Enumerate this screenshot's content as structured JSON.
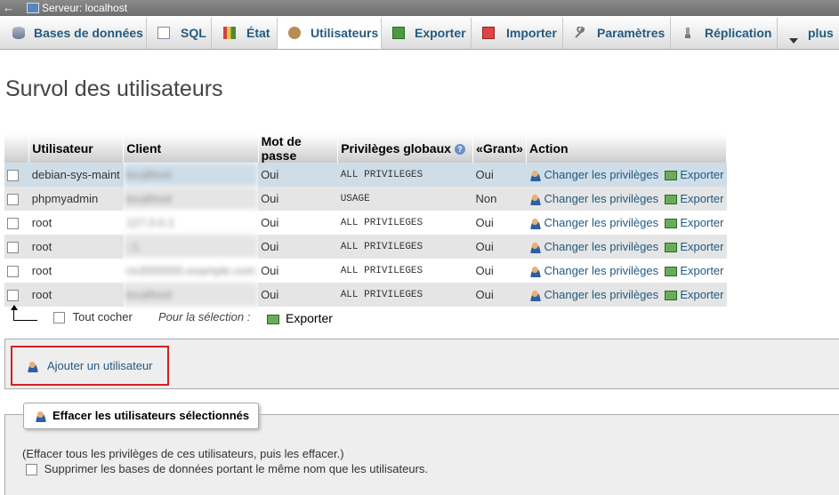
{
  "server_bar": {
    "back": "←",
    "title": "Serveur: localhost"
  },
  "tabs": [
    {
      "label": "Bases de données",
      "icon": "database-icon"
    },
    {
      "label": "SQL",
      "icon": "sql-icon"
    },
    {
      "label": "État",
      "icon": "status-icon"
    },
    {
      "label": "Utilisateurs",
      "icon": "users-icon",
      "active": true
    },
    {
      "label": "Exporter",
      "icon": "export-icon"
    },
    {
      "label": "Importer",
      "icon": "import-icon"
    },
    {
      "label": "Paramètres",
      "icon": "wrench-icon"
    },
    {
      "label": "Réplication",
      "icon": "replication-icon"
    },
    {
      "label": "plus",
      "icon": "chevron-down-icon"
    }
  ],
  "page_title": "Survol des utilisateurs",
  "table": {
    "headers": [
      "Utilisateur",
      "Client",
      "Mot de passe",
      "Privilèges globaux",
      "«Grant»",
      "Action"
    ],
    "rows": [
      {
        "user": "debian-sys-maint",
        "client": "localhost",
        "password": "Oui",
        "privileges": "ALL PRIVILEGES",
        "grant": "Oui",
        "edit": "Changer les privilèges",
        "export": "Exporter"
      },
      {
        "user": "phpmyadmin",
        "client": "localhost",
        "password": "Oui",
        "privileges": "USAGE",
        "grant": "Non",
        "edit": "Changer les privilèges",
        "export": "Exporter"
      },
      {
        "user": "root",
        "client": "127.0.0.1",
        "password": "Oui",
        "privileges": "ALL PRIVILEGES",
        "grant": "Oui",
        "edit": "Changer les privilèges",
        "export": "Exporter"
      },
      {
        "user": "root",
        "client": "::1",
        "password": "Oui",
        "privileges": "ALL PRIVILEGES",
        "grant": "Oui",
        "edit": "Changer les privilèges",
        "export": "Exporter"
      },
      {
        "user": "root",
        "client": "ns3000000.example.com",
        "password": "Oui",
        "privileges": "ALL PRIVILEGES",
        "grant": "Oui",
        "edit": "Changer les privilèges",
        "export": "Exporter"
      },
      {
        "user": "root",
        "client": "localhost",
        "password": "Oui",
        "privileges": "ALL PRIVILEGES",
        "grant": "Oui",
        "edit": "Changer les privilèges",
        "export": "Exporter"
      }
    ]
  },
  "footer": {
    "check_all": "Tout cocher",
    "for_selection": "Pour la sélection :",
    "export": "Exporter"
  },
  "add_user": "Ajouter un utilisateur",
  "delete_section": {
    "legend": "Effacer les utilisateurs sélectionnés",
    "note": "(Effacer tous les privilèges de ces utilisateurs, puis les effacer.)",
    "option": "Supprimer les bases de données portant le même nom que les utilisateurs."
  }
}
